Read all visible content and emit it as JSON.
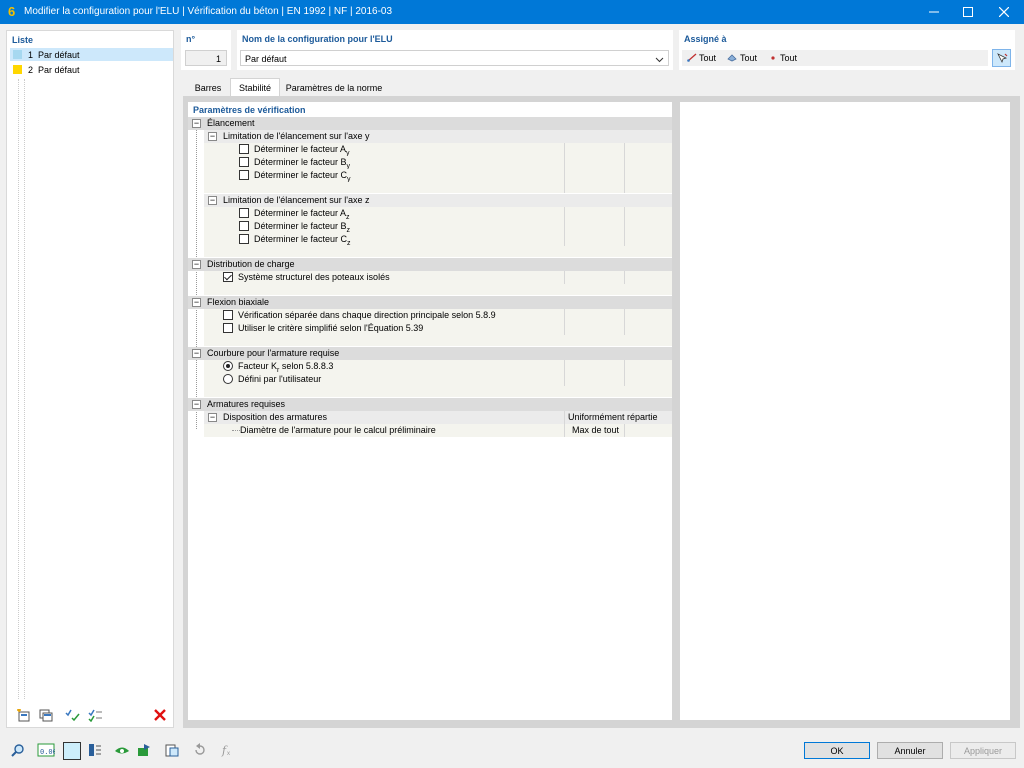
{
  "window": {
    "title": "Modifier la configuration pour l'ELU | Vérification du béton | EN 1992 | NF | 2016-03",
    "icon_glyph": "6",
    "controls": {
      "minimize": "minimize-icon",
      "maximize": "maximize-icon",
      "close": "close-icon"
    }
  },
  "list": {
    "header": "Liste",
    "items": [
      {
        "num": "1",
        "label": "Par défaut",
        "color": "#a6d8f0",
        "selected": true
      },
      {
        "num": "2",
        "label": "Par défaut",
        "color": "#ffd700",
        "selected": false
      }
    ],
    "toolbar": [
      "new-icon",
      "copy-icon",
      "check-icon",
      "check-list-icon",
      "delete-icon"
    ]
  },
  "config": {
    "number_label": "n°",
    "number_value": "1",
    "name_label": "Nom de la configuration pour l'ELU",
    "name_value": "Par défaut",
    "assigned_label": "Assigné à",
    "assigned": [
      {
        "icon": "member-icon",
        "label": "Tout"
      },
      {
        "icon": "member-set-icon",
        "label": "Tout"
      },
      {
        "icon": "node-icon",
        "label": "Tout"
      }
    ]
  },
  "tabs": [
    {
      "label": "Barres",
      "active": false
    },
    {
      "label": "Stabilité",
      "active": true
    },
    {
      "label": "Paramètres de la norme",
      "active": false
    }
  ],
  "grid": {
    "title": "Paramètres de vérification",
    "sections": {
      "elancement": "Élancement",
      "lim_y": "Limitation de l'élancement sur l'axe y",
      "ay": "Déterminer le facteur A",
      "by": "Déterminer le facteur B",
      "cy": "Déterminer le facteur C",
      "sub_y": "y",
      "lim_z": "Limitation de l'élancement sur l'axe z",
      "az": "Déterminer le facteur A",
      "bz": "Déterminer le facteur B",
      "cz": "Déterminer le facteur C",
      "sub_z": "z",
      "distribution": "Distribution de charge",
      "systeme": "Système structurel des poteaux isolés",
      "flexion": "Flexion biaxiale",
      "separee": "Vérification séparée dans chaque direction principale selon 5.8.9",
      "critere": "Utiliser le critère simplifié selon l'Équation 5.39",
      "courbure": "Courbure pour l'armature requise",
      "facteur_kr": "Facteur K",
      "facteur_kr_sub": "r",
      "facteur_kr_rest": " selon 5.8.8.3",
      "defini": "Défini par l'utilisateur",
      "armatures": "Armatures requises",
      "disposition": "Disposition des armatures",
      "disposition_value": "Uniformément répartie",
      "diametre": "Diamètre de l'armature pour le calcul préliminaire",
      "diametre_value": "Max de tout"
    },
    "checks": {
      "ay": false,
      "by": false,
      "cy": false,
      "az": false,
      "bz": false,
      "cz": false,
      "systeme": true,
      "separee": false,
      "critere": false
    },
    "radio": {
      "facteur_kr": true,
      "defini": false
    }
  },
  "bottom": {
    "tools": [
      "search-icon",
      "units-icon",
      "color-icon",
      "info-icon",
      "view-icon",
      "export-icon",
      "clipboard-icon",
      "reset-icon",
      "formula-icon"
    ],
    "units_text": "0.00",
    "ok": "OK",
    "cancel": "Annuler",
    "apply": "Appliquer"
  }
}
